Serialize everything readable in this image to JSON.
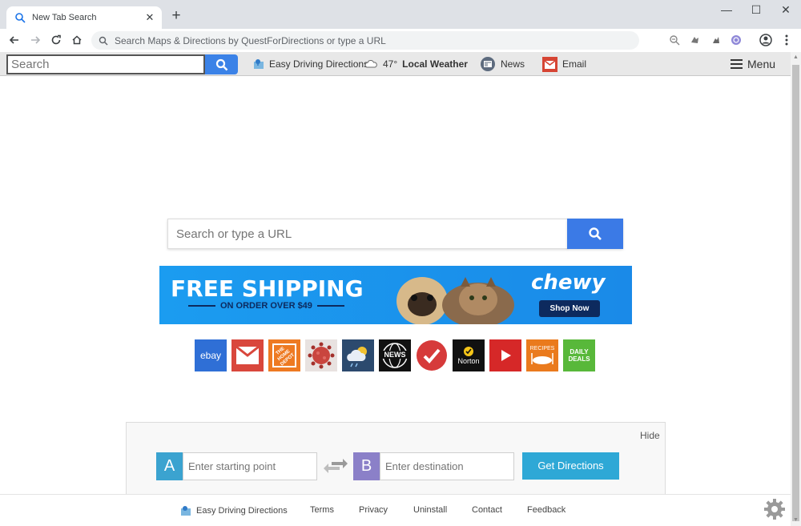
{
  "browser": {
    "tab_title": "New Tab Search",
    "tab_close": "✕",
    "new_tab": "+",
    "window_controls": {
      "minimize": "—",
      "maximize": "☐",
      "close": "✕"
    },
    "omnibox_placeholder": "Search Maps & Directions by QuestForDirections or type a URL"
  },
  "topbar": {
    "search_placeholder": "Search",
    "easy_driving": "Easy Driving Directions",
    "weather_temp": "47°",
    "weather_label": "Local Weather",
    "news": "News",
    "email": "Email",
    "menu": "Menu"
  },
  "main": {
    "search_placeholder": "Search or type a URL"
  },
  "banner": {
    "headline": "FREE SHIPPING",
    "subline": "ON ORDER OVER $49",
    "brand": "chewy",
    "cta": "Shop Now"
  },
  "tiles": [
    {
      "name": "ebay",
      "label": "ebay",
      "color": "#2f6fd6"
    },
    {
      "name": "gmail",
      "label": "",
      "color": "#d9473c"
    },
    {
      "name": "home-depot",
      "label": "THE HOME DEPOT",
      "color": "#ee7a22"
    },
    {
      "name": "virus-tracker",
      "label": "",
      "color": "#e8e2e0"
    },
    {
      "name": "weather",
      "label": "",
      "color": "#2c4a6e"
    },
    {
      "name": "news",
      "label": "NEWS",
      "color": "#111111"
    },
    {
      "name": "todo",
      "label": "",
      "color": "#ffffff"
    },
    {
      "name": "norton",
      "label": "Norton",
      "color": "#111111"
    },
    {
      "name": "youtube",
      "label": "",
      "color": "#d62828"
    },
    {
      "name": "recipes",
      "label": "RECIPES",
      "color": "#ea7a1d"
    },
    {
      "name": "daily-deals",
      "label": "DAILY DEALS",
      "color": "#58b83a"
    }
  ],
  "directions": {
    "hide": "Hide",
    "a_label": "A",
    "b_label": "B",
    "start_placeholder": "Enter starting point",
    "dest_placeholder": "Enter destination",
    "go": "Get Directions"
  },
  "footer": {
    "easy_driving": "Easy Driving Directions",
    "terms": "Terms",
    "privacy": "Privacy",
    "uninstall": "Uninstall",
    "contact": "Contact",
    "feedback": "Feedback"
  },
  "colors": {
    "accent_blue": "#3b7ae6",
    "directions_go": "#2ea8d6",
    "a_badge": "#3ba3d0",
    "b_badge": "#8b80c8"
  }
}
